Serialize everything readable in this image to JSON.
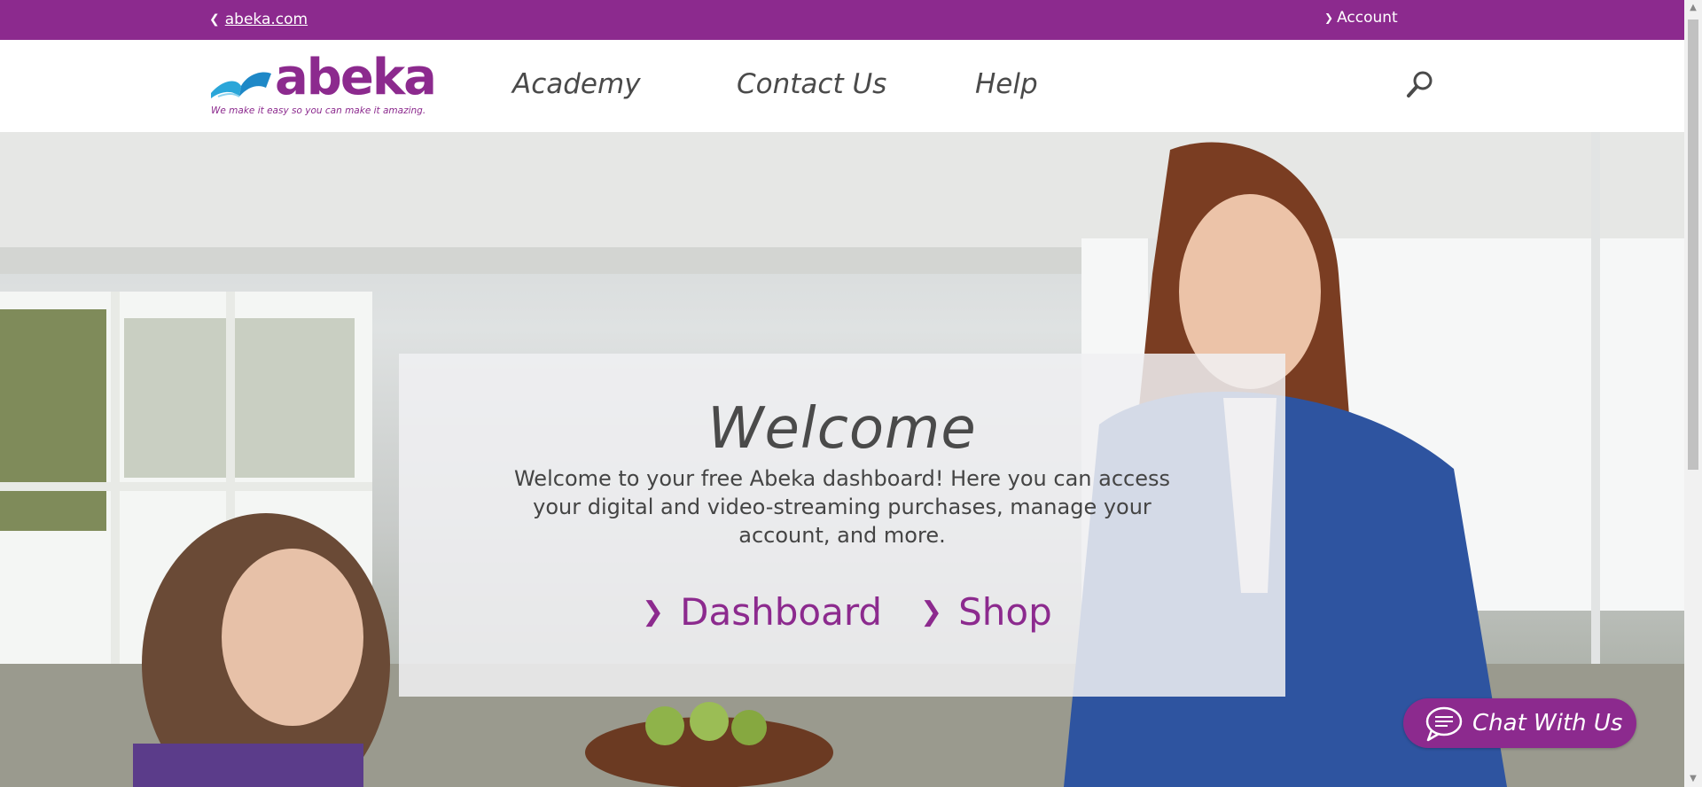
{
  "topbar": {
    "back_label": "abeka.com",
    "account_label": "Account"
  },
  "logo": {
    "wordmark": "abeka",
    "tagline": "We make it easy so you can make it amazing."
  },
  "nav": {
    "items": [
      {
        "label": "Academy"
      },
      {
        "label": "Contact Us"
      },
      {
        "label": "Help"
      }
    ]
  },
  "hero": {
    "title": "Welcome",
    "description": "Welcome to your free Abeka dashboard! Here you can access your digital and video-streaming purchases, manage your account, and more.",
    "links": [
      {
        "label": "Dashboard"
      },
      {
        "label": "Shop"
      }
    ]
  },
  "chat": {
    "label": "Chat With Us"
  },
  "colors": {
    "brand": "#8c2a8e",
    "text": "#4a4a4a"
  },
  "icons": [
    "chevron-left-icon",
    "chevron-down-icon",
    "search-icon",
    "chevron-right-icon",
    "chat-bubble-icon"
  ]
}
